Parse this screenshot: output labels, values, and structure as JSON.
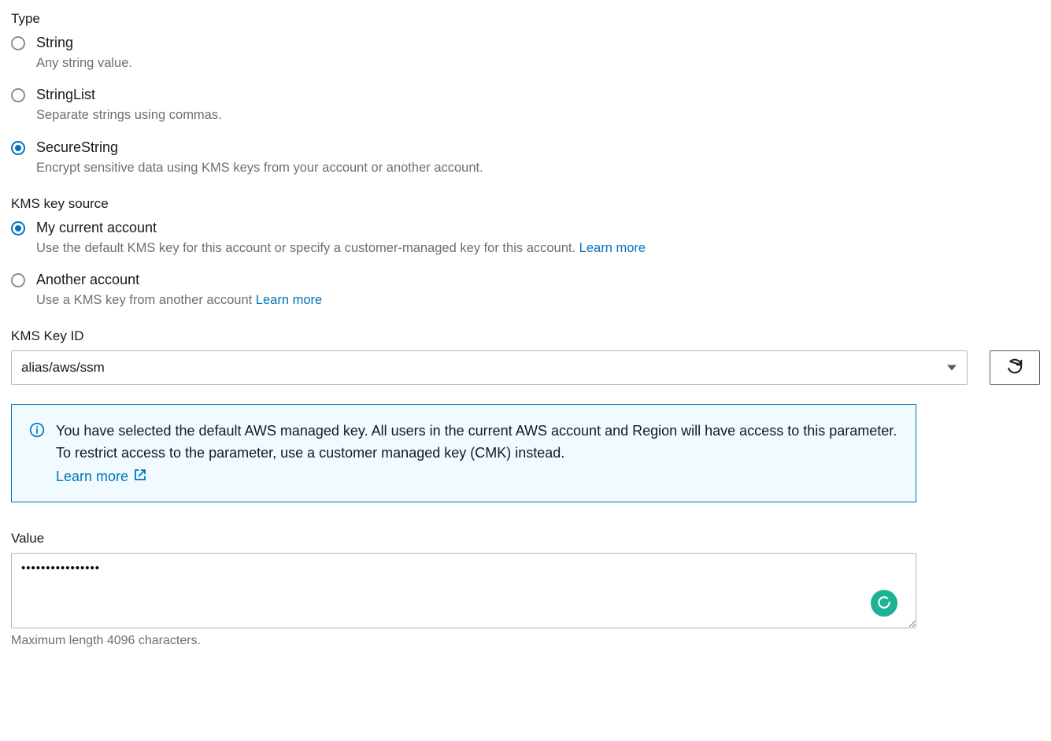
{
  "type_section": {
    "label": "Type",
    "options": [
      {
        "title": "String",
        "desc": "Any string value.",
        "selected": false
      },
      {
        "title": "StringList",
        "desc": "Separate strings using commas.",
        "selected": false
      },
      {
        "title": "SecureString",
        "desc": "Encrypt sensitive data using KMS keys from your account or another account.",
        "selected": true
      }
    ]
  },
  "kms_source_section": {
    "label": "KMS key source",
    "options": [
      {
        "title": "My current account",
        "desc_prefix": "Use the default KMS key for this account or specify a customer-managed key for this account. ",
        "learn_more": "Learn more",
        "selected": true
      },
      {
        "title": "Another account",
        "desc_prefix": "Use a KMS key from another account ",
        "learn_more": "Learn more",
        "selected": false
      }
    ]
  },
  "kms_key_id": {
    "label": "KMS Key ID",
    "value": "alias/aws/ssm"
  },
  "info_box": {
    "text": "You have selected the default AWS managed key. All users in the current AWS account and Region will have access to this parameter. To restrict access to the parameter, use a customer managed key (CMK) instead.",
    "learn_more": "Learn more"
  },
  "value_section": {
    "label": "Value",
    "value": "••••••••••••••••",
    "hint": "Maximum length 4096 characters."
  }
}
